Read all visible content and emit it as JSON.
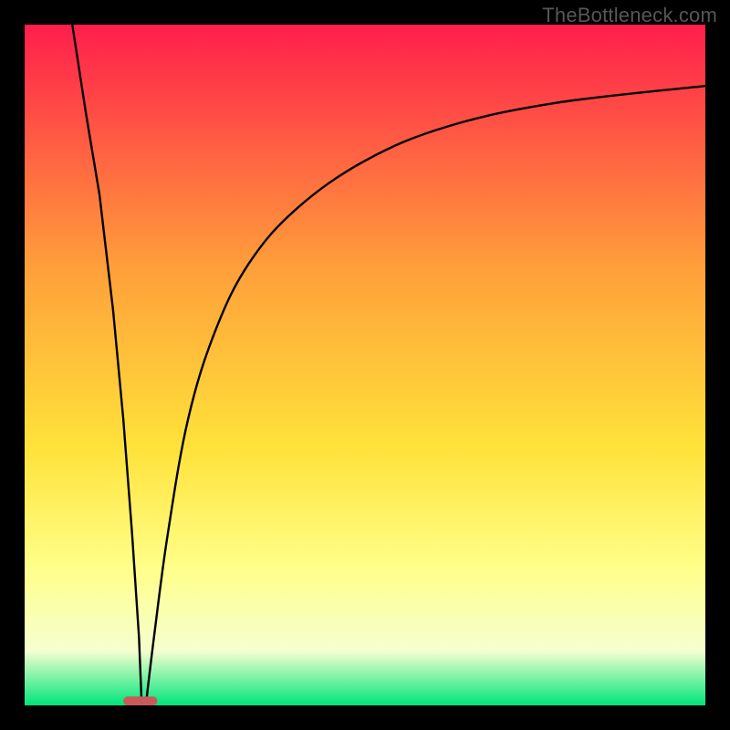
{
  "attribution": "TheBottleneck.com",
  "chart_data": {
    "type": "line",
    "title": "",
    "xlabel": "",
    "ylabel": "",
    "xlim": [
      0,
      100
    ],
    "ylim": [
      0,
      100
    ],
    "grid": false,
    "legend": false,
    "colors": {
      "frame": "#000000",
      "curve": "#000000",
      "gradient_top": "#ff1e4c",
      "gradient_mid_upper": "#ffa03a",
      "gradient_mid": "#ffe23a",
      "gradient_mid_lower": "#ffff8a",
      "gradient_low_pale": "#f5ffd0",
      "gradient_bottom": "#00e57a",
      "marker": "#c95a5a"
    },
    "marker": {
      "x": 17,
      "y": 0,
      "width": 5,
      "height": 1.3
    },
    "series": [
      {
        "name": "bottleneck-curve-left",
        "x": [
          7,
          9,
          11,
          13,
          14.5,
          15.8,
          16.8,
          17.2
        ],
        "values": [
          100,
          87,
          75,
          58,
          42,
          25,
          10,
          0
        ]
      },
      {
        "name": "bottleneck-curve-right",
        "x": [
          17.8,
          19,
          21,
          24,
          28,
          33,
          40,
          50,
          62,
          78,
          100
        ],
        "values": [
          0,
          10,
          25,
          42,
          55,
          65,
          73,
          80,
          85,
          88.5,
          91
        ]
      }
    ]
  }
}
